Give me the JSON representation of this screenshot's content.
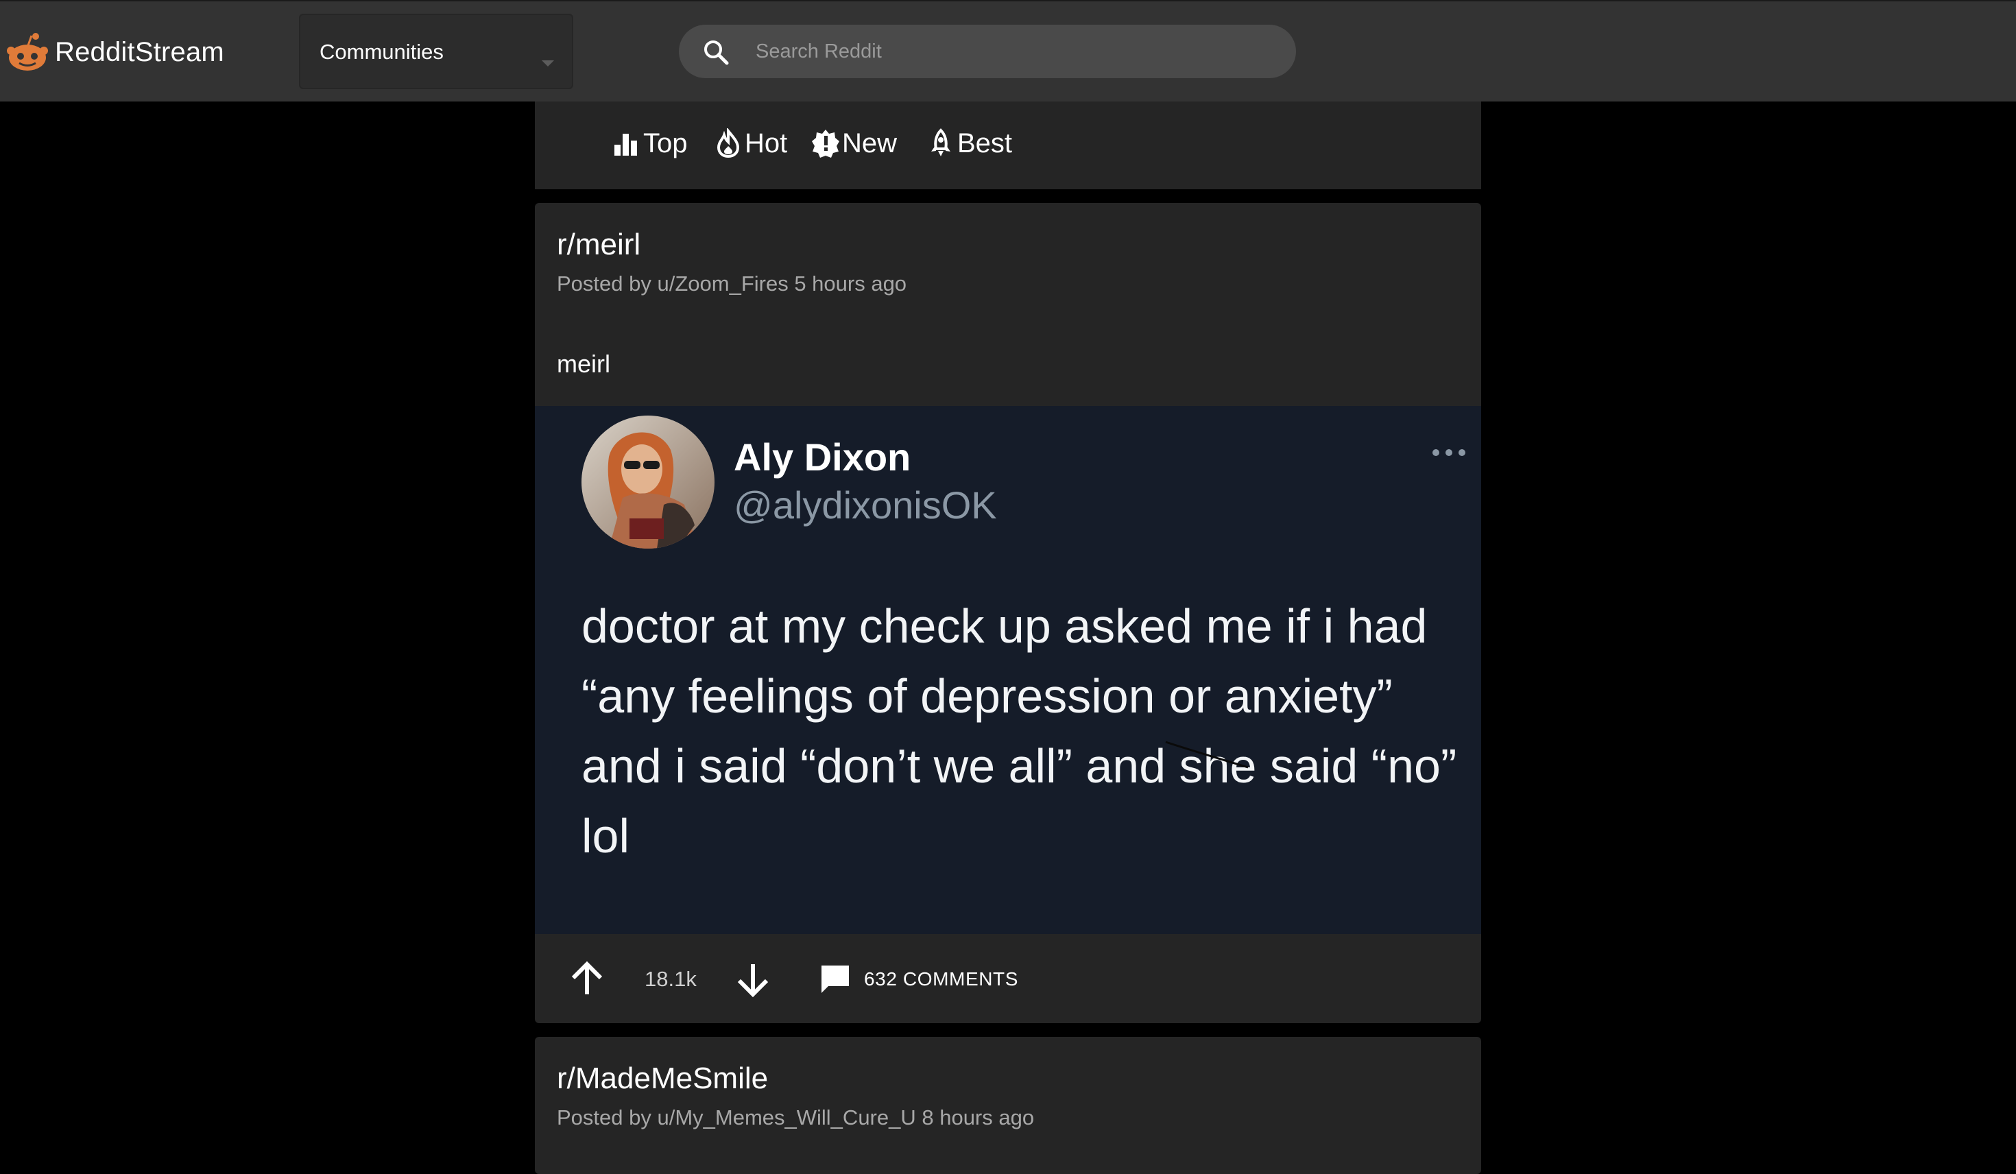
{
  "header": {
    "brand_name": "RedditStream",
    "communities_label": "Communities",
    "search_placeholder": "Search Reddit"
  },
  "sort_options": [
    {
      "label": "Top",
      "icon": "bar-chart-icon"
    },
    {
      "label": "Hot",
      "icon": "flame-icon"
    },
    {
      "label": "New",
      "icon": "new-badge-icon"
    },
    {
      "label": "Best",
      "icon": "rocket-icon"
    }
  ],
  "posts": [
    {
      "subreddit": "r/meirl",
      "meta": "Posted by u/Zoom_Fires 5 hours ago",
      "title": "meirl",
      "media": {
        "tweet_name": "Aly Dixon",
        "tweet_handle": "@alydixonisOK",
        "tweet_text": "doctor at my check up asked me if i had “any feelings of depression or anxiety” and i said “don’t we all” and she said “no” lol"
      },
      "score": "18.1k",
      "comments_label": "632 COMMENTS"
    },
    {
      "subreddit": "r/MadeMeSmile",
      "meta": "Posted by u/My_Memes_Will_Cure_U 8 hours ago"
    }
  ],
  "colors": {
    "topbar": "#333333",
    "card": "#252525",
    "page_background": "#000000",
    "media_background": "#151c29",
    "logo_orange": "#e07b39"
  }
}
